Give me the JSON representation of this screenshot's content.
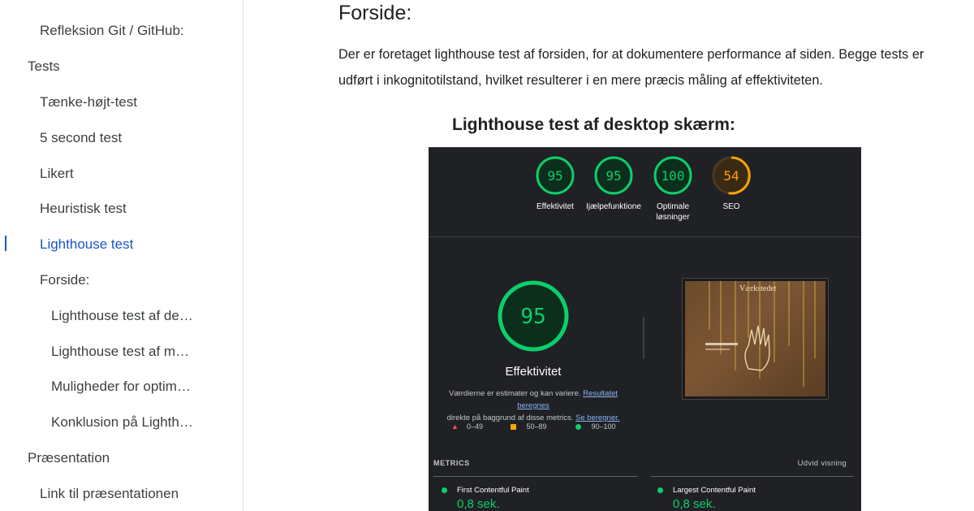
{
  "sidebar": {
    "items": [
      {
        "label": "Refleksion Git / GitHub:",
        "level": 2
      },
      {
        "label": "Tests",
        "level": 1
      },
      {
        "label": "Tænke-højt-test",
        "level": 2
      },
      {
        "label": "5 second test",
        "level": 2
      },
      {
        "label": "Likert",
        "level": 2
      },
      {
        "label": "Heuristisk test",
        "level": 2
      },
      {
        "label": "Lighthouse test",
        "level": 2,
        "active": true
      },
      {
        "label": "Forside:",
        "level": 2
      },
      {
        "label": "Lighthouse test af de…",
        "level": 3
      },
      {
        "label": "Lighthouse test af m…",
        "level": 3
      },
      {
        "label": "Muligheder for optim…",
        "level": 3
      },
      {
        "label": "Konklusion på Lighth…",
        "level": 3
      },
      {
        "label": "Præsentation",
        "level": 1
      },
      {
        "label": "Link til præsentationen",
        "level": 2
      }
    ]
  },
  "main": {
    "heading": "Forside:",
    "paragraph": "Der er foretaget lighthouse test af forsiden, for at dokumentere performance af siden. Begge tests er udført i inkognitotilstand, hvilket resulterer i en mere præcis måling af effektiviteten.",
    "subheading": "Lighthouse test af desktop skærm:"
  },
  "lighthouse": {
    "scores": [
      {
        "value": "95",
        "label": "Effektivitet",
        "color": "#0cce6b"
      },
      {
        "value": "95",
        "label": "Ijælpefunktione",
        "color": "#0cce6b"
      },
      {
        "value": "100",
        "label": "Optimale løsninger",
        "color": "#0cce6b"
      },
      {
        "value": "54",
        "label": "SEO",
        "color": "#ffa400"
      }
    ],
    "main_score": "95",
    "main_label": "Effektivitet",
    "desc_text": "Værdierne er estimater og kan variere. ",
    "desc_link1": "Resultatet beregnes",
    "desc_text2": "direkte på baggrund af disse metrics. ",
    "desc_link2": "Se beregner.",
    "legend": [
      "0–49",
      "50–89",
      "90–100"
    ],
    "thumbnail_title": "Værkstedet",
    "metrics_label": "METRICS",
    "expand_label": "Udvid visning",
    "metrics": [
      {
        "name": "First Contentful Paint",
        "value": "0,8 sek."
      },
      {
        "name": "Largest Contentful Paint",
        "value": "0,8 sek."
      }
    ],
    "colors": {
      "pass": "#0cce6b",
      "average": "#ffa400",
      "fail": "#ff4e42",
      "bg": "#202124"
    }
  }
}
